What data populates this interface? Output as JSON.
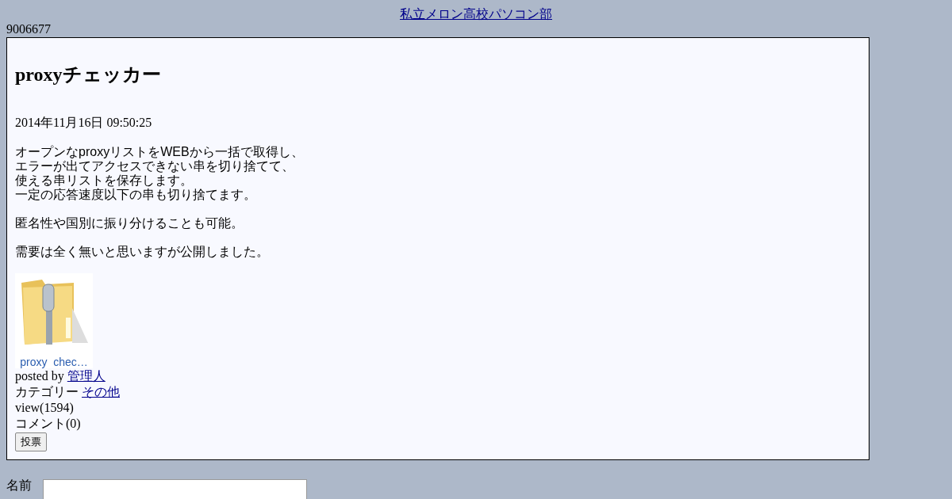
{
  "site_link": "私立メロン高校パソコン部",
  "counter": "9006677",
  "post": {
    "title": "proxyチェッカー",
    "date": "2014年11月16日 09:50:25",
    "paragraphs": [
      [
        "オープンなproxyリストをWEBから一括で取得し、",
        "エラーが出てアクセスできない串を切り捨てて、",
        "使える串リストを保存します。",
        "一定の応答速度以下の串も切り捨てます。"
      ],
      [
        "匿名性や国別に振り分けることも可能。"
      ],
      [
        "需要は全く無いと思いますが公開しました。"
      ]
    ],
    "attachment": {
      "label": "proxy  chec…"
    },
    "posted_by_label": "posted by",
    "author": "管理人",
    "category_label": "カテゴリー",
    "category": "その他",
    "views": "view(1594)",
    "comments": "コメント(0)",
    "vote_button": "投票"
  },
  "comment_form": {
    "name_label": "名前"
  }
}
